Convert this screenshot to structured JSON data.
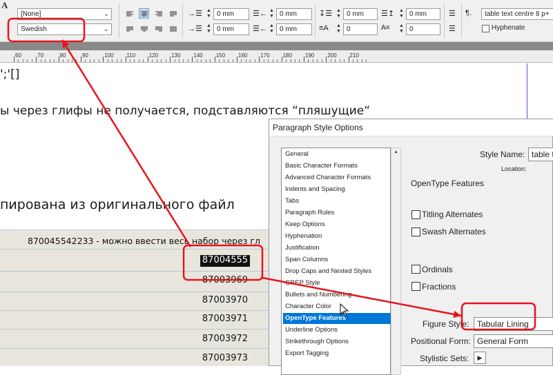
{
  "control_panel": {
    "char_style_value": "[None]",
    "language_value": "Swedish",
    "indent_left": "0 mm",
    "indent_right": "0 mm",
    "first_line_indent": "0 mm",
    "last_line_indent": "0 mm",
    "space_before": "0 mm",
    "space_after": "0 mm",
    "drop_cap_lines": "0",
    "drop_cap_chars": "0",
    "pilcrow": "¶.",
    "paragraph_style": "table text centre 8 p+",
    "hyphenate_label": "Hyphenate",
    "font_glyph": "A"
  },
  "ruler": {
    "labels": [
      "60",
      "70",
      "80",
      "90",
      "100",
      "110",
      "120",
      "130",
      "140",
      "150",
      "160",
      "170",
      "180",
      "190",
      "200",
      "210"
    ]
  },
  "document": {
    "line1": "';'[]",
    "line2": "ы через глифы не получается, подставляются “пляшущие“",
    "line3": "пирована из оригинального файл",
    "table_header": "870045542233 - можно ввести весь набор через гл",
    "rows": [
      "87004555",
      "87003969",
      "87003970",
      "87003971",
      "87003972",
      "87003973"
    ]
  },
  "dialog": {
    "title": "Paragraph Style Options",
    "style_name_label": "Style Name:",
    "style_name_value": "table t",
    "location_label": "Location:",
    "section_heading": "OpenType Features",
    "titling_label": "Titling Alternates",
    "swash_label": "Swash Alternates",
    "ordinals_label": "Ordinals",
    "fractions_label": "Fractions",
    "figure_style_label": "Figure Style:",
    "figure_style_value": "Tabular Lining",
    "positional_label": "Positional Form:",
    "positional_value": "General Form",
    "stylistic_label": "Stylistic Sets:",
    "panels": [
      "General",
      "Basic Character Formats",
      "Advanced Character Formats",
      "Indents and Spacing",
      "Tabs",
      "Paragraph Rules",
      "Keep Options",
      "Hyphenation",
      "Justification",
      "Span Columns",
      "Drop Caps and Nested Styles",
      "GREP Style",
      "Bullets and Numbering",
      "Character Color",
      "OpenType Features",
      "Underline Options",
      "Strikethrough Options",
      "Export Tagging"
    ]
  },
  "annotation_color": "#e8141c"
}
